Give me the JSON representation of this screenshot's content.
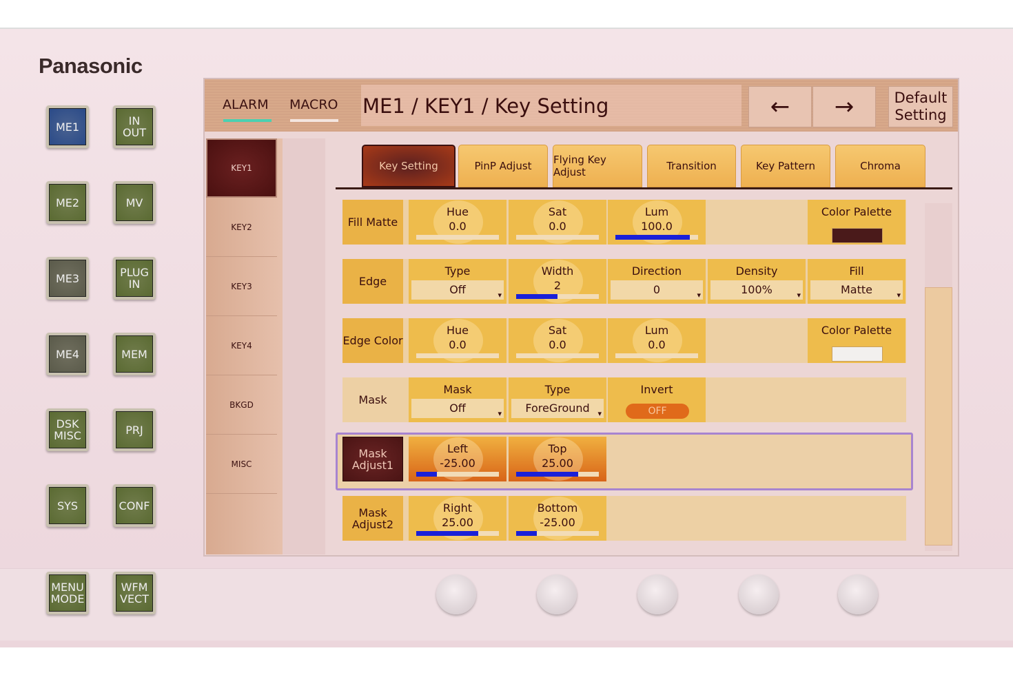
{
  "brand": "Panasonic",
  "hardware_buttons": [
    {
      "label": "ME1",
      "color": "#2a4a88"
    },
    {
      "label": "IN OUT",
      "color": "#5a6a32"
    },
    {
      "label": "ME2",
      "color": "#5a6a32"
    },
    {
      "label": "MV",
      "color": "#5a6a32"
    },
    {
      "label": "ME3",
      "color": "#5a5a4a"
    },
    {
      "label": "PLUG IN",
      "color": "#5a6a32"
    },
    {
      "label": "ME4",
      "color": "#5a5a4a"
    },
    {
      "label": "MEM",
      "color": "#5a6a32"
    },
    {
      "label": "DSK MISC",
      "color": "#5a6a32"
    },
    {
      "label": "PRJ",
      "color": "#5a6a32"
    },
    {
      "label": "SYS",
      "color": "#5a6a32"
    },
    {
      "label": "CONF",
      "color": "#5a6a32"
    },
    {
      "label": "MENU MODE",
      "color": "#5a6a32"
    },
    {
      "label": "WFM VECT",
      "color": "#5a6a32"
    }
  ],
  "header": {
    "alarm": "ALARM",
    "alarm_indicator_color": "#4ad0b0",
    "macro": "MACRO",
    "title": "ME1 / KEY1 / Key Setting",
    "back_icon": "arrow-left-icon",
    "back": "←",
    "forward_icon": "arrow-right-icon",
    "forward": "→",
    "default_setting": "Default Setting"
  },
  "sidebar": {
    "items": [
      {
        "label": "KEY1",
        "active": true
      },
      {
        "label": "KEY2"
      },
      {
        "label": "KEY3"
      },
      {
        "label": "KEY4"
      },
      {
        "label": "BKGD"
      },
      {
        "label": "MISC"
      }
    ]
  },
  "tabs": [
    {
      "label": "Key Setting",
      "active": true
    },
    {
      "label": "PinP Adjust"
    },
    {
      "label": "Flying Key Adjust"
    },
    {
      "label": "Transition"
    },
    {
      "label": "Key Pattern"
    },
    {
      "label": "Chroma"
    }
  ],
  "rows": {
    "fill_matte": {
      "label": "Fill Matte",
      "hue": {
        "label": "Hue",
        "value": "0.0",
        "level": 0
      },
      "sat": {
        "label": "Sat",
        "value": "0.0",
        "level": 0
      },
      "lum": {
        "label": "Lum",
        "value": "100.0",
        "level": 0.9
      },
      "palette": {
        "label": "Color Palette",
        "color": "#4a1a1a"
      }
    },
    "edge": {
      "label": "Edge",
      "type": {
        "label": "Type",
        "value": "Off"
      },
      "width": {
        "label": "Width",
        "value": "2",
        "level": 0.5
      },
      "direction": {
        "label": "Direction",
        "value": "0"
      },
      "density": {
        "label": "Density",
        "value": "100%"
      },
      "fill": {
        "label": "Fill",
        "value": "Matte"
      }
    },
    "edge_color": {
      "label": "Edge Color",
      "hue": {
        "label": "Hue",
        "value": "0.0",
        "level": 0
      },
      "sat": {
        "label": "Sat",
        "value": "0.0",
        "level": 0
      },
      "lum": {
        "label": "Lum",
        "value": "0.0",
        "level": 0
      },
      "palette": {
        "label": "Color Palette",
        "color": "#f2f0ee"
      }
    },
    "mask": {
      "label": "Mask",
      "mask": {
        "label": "Mask",
        "value": "Off"
      },
      "type": {
        "label": "Type",
        "value": "ForeGround"
      },
      "invert": {
        "label": "Invert",
        "value": "OFF"
      }
    },
    "mask_adjust1": {
      "label": "Mask Adjust1",
      "selected": true,
      "left": {
        "label": "Left",
        "value": "-25.00",
        "level": 0.25
      },
      "top": {
        "label": "Top",
        "value": "25.00",
        "level": 0.75
      }
    },
    "mask_adjust2": {
      "label": "Mask Adjust2",
      "right": {
        "label": "Right",
        "value": "25.00",
        "level": 0.75
      },
      "bottom": {
        "label": "Bottom",
        "value": "-25.00",
        "level": 0.25
      }
    }
  }
}
